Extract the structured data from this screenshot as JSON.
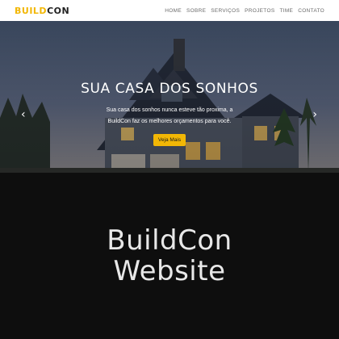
{
  "navbar": {
    "logo_accent": "BUILD",
    "logo_rest": "CON",
    "links": [
      "HOME",
      "SOBRE",
      "SERVIÇOS",
      "PROJETOS",
      "TIME",
      "CONTATO"
    ]
  },
  "hero": {
    "title": "SUA CASA DOS SONHOS",
    "text": "Sua casa dos sonhos nunca esteve tão proxima, a BuildCon faz os melhores orçamentos para você.",
    "cta_label": "Veja Mais",
    "prev_arrow": "‹",
    "next_arrow": "›"
  },
  "banner": {
    "line1": "BuildCon",
    "line2": "Website"
  },
  "colors": {
    "accent": "#f2b705",
    "banner_bg": "#0e0e0e",
    "banner_text": "#e8e8e8"
  }
}
